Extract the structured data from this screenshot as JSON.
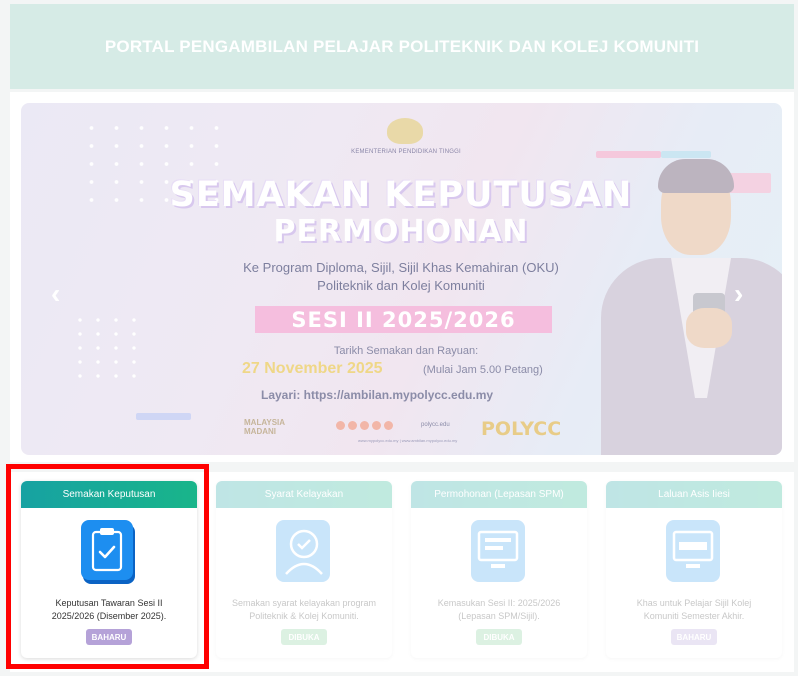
{
  "header": {
    "title": "PORTAL PENGAMBILAN PELAJAR POLITEKNIK DAN KOLEJ KOMUNITI"
  },
  "banner": {
    "ministry": "KEMENTERIAN PENDIDIKAN TINGGI",
    "headline_line1": "SEMAKAN KEPUTUSAN",
    "headline_line2": "PERMOHONAN",
    "subtitle_line1": "Ke Program Diploma, Sijil, Sijil Khas Kemahiran (OKU)",
    "subtitle_line2": "Politeknik dan Kolej Komuniti",
    "session": "SESI II 2025/2026",
    "date_label": "Tarikh Semakan dan Rayuan:",
    "date_value": "27 November 2025",
    "date_time": "(Mulai Jam 5.00 Petang)",
    "link": "Layari: https://ambilan.mypolycc.edu.my",
    "logo_left": "MALAYSIA MADANI",
    "social_handle": "polycc.edu",
    "urls": "www.mypolycc.edu.my | www.ambilan.mypolycc.edu.my",
    "logo_right": "POLYCC",
    "prev_icon": "chevron-left",
    "next_icon": "chevron-right"
  },
  "cards": [
    {
      "title": "Semakan Keputusan",
      "desc_line1": "Keputusan Tawaran Sesi II",
      "desc_line2": "2025/2026 (Disember 2025).",
      "badge": "BAHARU",
      "icon": "clipboard-check-icon"
    },
    {
      "title": "Syarat Kelayakan",
      "desc_line1": "Semakan syarat kelayakan program",
      "desc_line2": "Politeknik & Kolej Komuniti.",
      "badge": "DIBUKA",
      "icon": "user-check-gear-icon"
    },
    {
      "title": "Permohonan (Lepasan SPM)",
      "desc_line1": "Kemasukan Sesi II: 2025/2026",
      "desc_line2": "(Lepasan SPM/Sijil).",
      "badge": "DIBUKA",
      "icon": "monitor-form-icon"
    },
    {
      "title": "Laluan Asis Iiesi",
      "desc_line1": "Khas untuk Pelajar Sijil Kolej",
      "desc_line2": "Komuniti Semester Akhir.",
      "badge": "BAHARU",
      "icon": "monitor-laluan-icon"
    }
  ],
  "colors": {
    "card_header": "#17a2a2",
    "baharu": "#b5a2d8",
    "dibuka": "#7fcc97",
    "highlight": "#ff0000"
  }
}
